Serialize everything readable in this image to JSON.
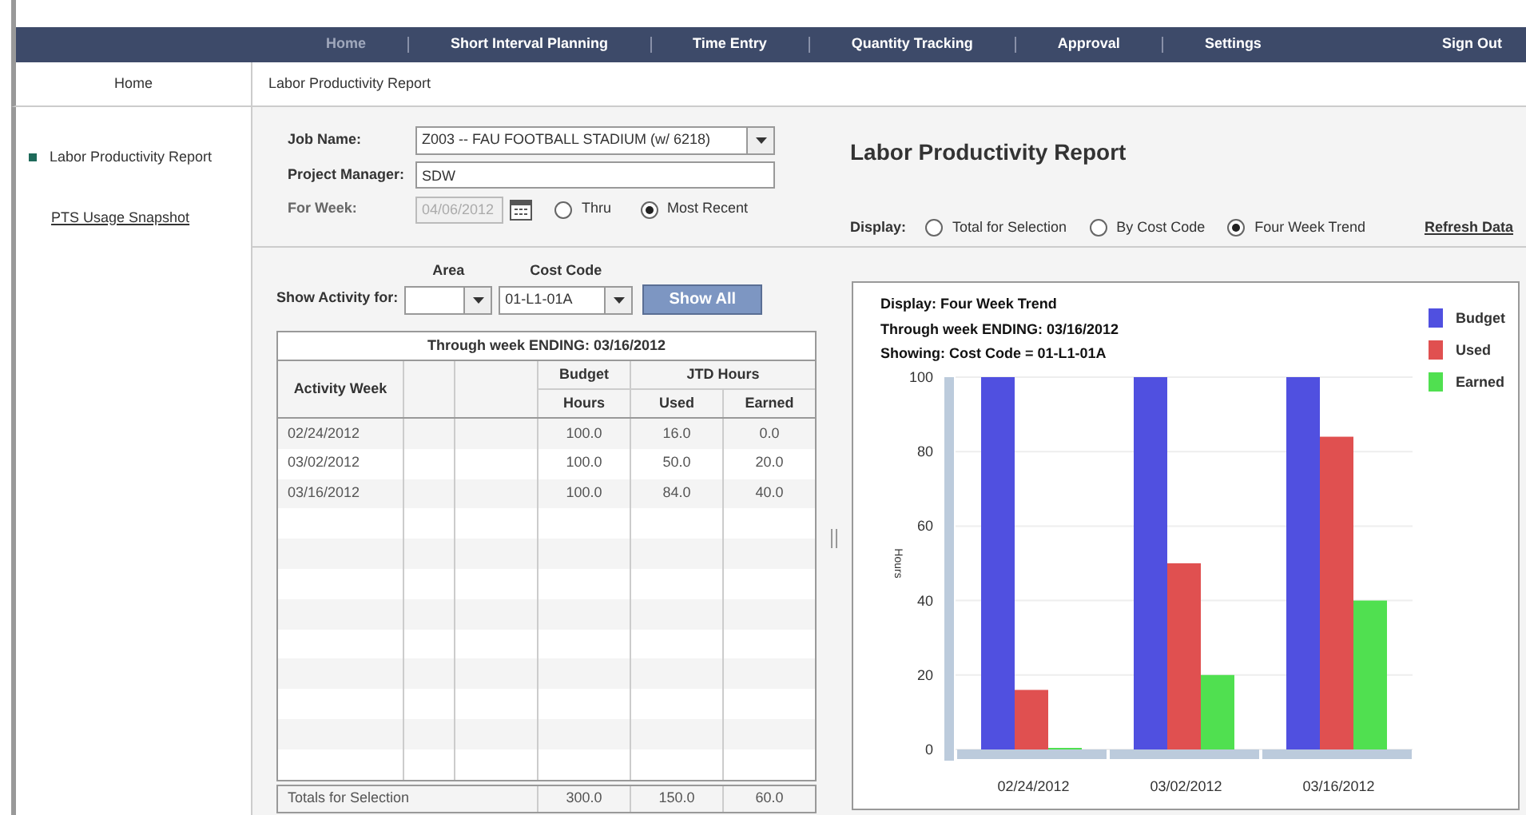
{
  "nav": [
    {
      "label": "Home",
      "selected": true
    },
    {
      "label": "Short Interval Planning",
      "selected": false
    },
    {
      "label": "Time Entry",
      "selected": false
    },
    {
      "label": "Quantity Tracking",
      "selected": false
    },
    {
      "label": "Approval",
      "selected": false
    },
    {
      "label": "Settings",
      "selected": false
    }
  ],
  "sign_out": "Sign Out",
  "breadcrumb": {
    "home": "Home",
    "current": "Labor Productivity Report"
  },
  "sidebar": {
    "items": [
      {
        "label": "Labor Productivity Report",
        "selected": true
      },
      {
        "label": "PTS Usage Snapshot",
        "selected": false
      }
    ]
  },
  "form": {
    "job_name_label": "Job Name:",
    "job_name": "Z003 -- FAU FOOTBALL STADIUM (w/ 6218)",
    "manager_label": "Project Manager:",
    "manager": "SDW",
    "week_label": "For Week:",
    "week": "04/06/2012",
    "week_disabled": true,
    "week_options": [
      {
        "label": "Thru",
        "selected": false
      },
      {
        "label": "Most Recent",
        "selected": true
      }
    ]
  },
  "report_title": "Labor Productivity Report",
  "display": {
    "label": "Display:",
    "options": [
      {
        "label": "Total for Selection",
        "selected": false
      },
      {
        "label": "By Cost Code",
        "selected": false
      },
      {
        "label": "Four Week Trend",
        "selected": true
      }
    ],
    "refresh": "Refresh Data"
  },
  "filter": {
    "label": "Show Activity for:",
    "area_label": "Area",
    "cost_code_label": "Cost Code",
    "cost_code": "01-L1-01A",
    "button": "Show All"
  },
  "table": {
    "caption": "Through week ENDING: 03/16/2012",
    "col_activity": "Activity Week",
    "col_budget": "Budget",
    "col_jtd": "JTD Hours",
    "col_hours": "Hours",
    "col_used": "Used",
    "col_earned": "Earned",
    "rows": [
      [
        "02/24/2012",
        "100.0",
        "16.0",
        "0.0"
      ],
      [
        "03/02/2012",
        "100.0",
        "50.0",
        "20.0"
      ],
      [
        "03/16/2012",
        "100.0",
        "84.0",
        "40.0"
      ]
    ],
    "totals": [
      "Totals for Selection",
      "300.0",
      "150.0",
      "60.0"
    ]
  },
  "chart": {
    "lines": [
      "Display: Four Week Trend",
      "Through week ENDING: 03/16/2012",
      "Showing: Cost Code = 01-L1-01A"
    ],
    "chart_data": {
      "type": "bar",
      "grid": true,
      "legend": true,
      "ylabel": "Hours",
      "categories": [
        "02/24/2012",
        "03/02/2012",
        "03/16/2012"
      ],
      "ylim": [
        0,
        100
      ],
      "yticks": [
        0,
        20,
        40,
        60,
        80,
        100
      ],
      "series": [
        {
          "name": "Budget",
          "color": "#5050e0",
          "values": [
            100,
            100,
            100
          ]
        },
        {
          "name": "Used",
          "color": "#e05050",
          "values": [
            16,
            50,
            84
          ]
        },
        {
          "name": "Earned",
          "color": "#50e050",
          "values": [
            0,
            20,
            40
          ]
        }
      ]
    }
  }
}
